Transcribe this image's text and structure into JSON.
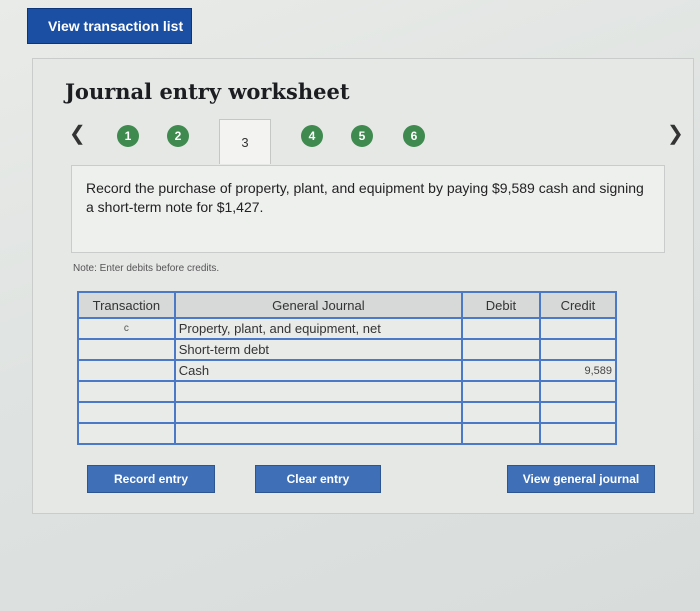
{
  "top": {
    "view_transaction_list": "View transaction list"
  },
  "worksheet": {
    "title": "Journal entry worksheet",
    "steps": [
      "1",
      "2",
      "3",
      "4",
      "5",
      "6"
    ],
    "active_step": "3",
    "description": "Record the purchase of property, plant, and equipment by paying $9,589 cash and signing a short-term note for $1,427.",
    "note": "Note: Enter debits before credits."
  },
  "journal": {
    "headers": {
      "transaction": "Transaction",
      "general_journal": "General Journal",
      "debit": "Debit",
      "credit": "Credit"
    },
    "rows": [
      {
        "transaction": "c",
        "account": "Property, plant, and equipment, net",
        "debit": "",
        "credit": ""
      },
      {
        "transaction": "",
        "account": "Short-term debt",
        "debit": "",
        "credit": ""
      },
      {
        "transaction": "",
        "account": "Cash",
        "debit": "",
        "credit": "9,589"
      },
      {
        "transaction": "",
        "account": "",
        "debit": "",
        "credit": ""
      },
      {
        "transaction": "",
        "account": "",
        "debit": "",
        "credit": ""
      },
      {
        "transaction": "",
        "account": "",
        "debit": "",
        "credit": ""
      }
    ]
  },
  "buttons": {
    "record": "Record entry",
    "clear": "Clear entry",
    "view_general": "View general journal"
  },
  "colors": {
    "step_green": "#3f8a4f",
    "button_blue": "#3f6fb7",
    "table_border": "#4b79c8"
  }
}
